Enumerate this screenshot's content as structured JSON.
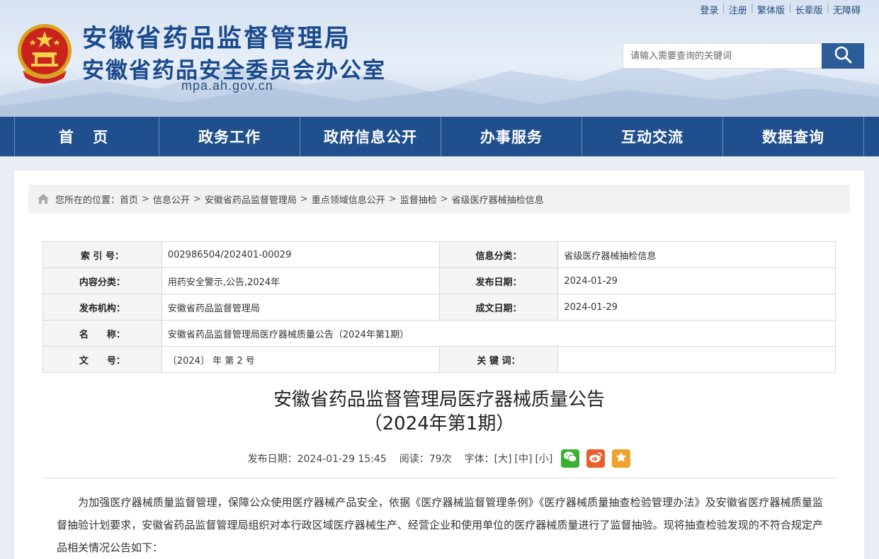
{
  "header": {
    "title_main": "安徽省药品监督管理局",
    "title_sub": "安徽省药品安全委员会办公室",
    "domain": "mpa.ah.gov.cn",
    "top_links": [
      "登录",
      "注册",
      "繁体版",
      "长辈版",
      "无障碍"
    ],
    "search_placeholder": "请输入需要查询的关键词",
    "emblem_icon": "national-emblem-icon",
    "search_icon": "magnifier-icon"
  },
  "nav": {
    "items": [
      "首 页",
      "政务工作",
      "政府信息公开",
      "办事服务",
      "互动交流",
      "数据查询"
    ]
  },
  "breadcrumb": {
    "prefix": "您所在的位置：",
    "items": [
      "首页",
      "信息公开",
      "安徽省药品监督管理局",
      "重点领域信息公开",
      "监督抽检",
      "省级医疗器械抽检信息"
    ],
    "separator": ">"
  },
  "meta": {
    "index_label": "索 引 号：",
    "index_value": "002986504/202401-00029",
    "category_label": "信息分类：",
    "category_value": "省级医疗器械抽检信息",
    "content_type_label": "内容分类：",
    "content_type_value": "用药安全警示,公告,2024年",
    "publish_date_label": "发布日期：",
    "publish_date_value": "2024-01-29",
    "org_label": "发布机构：",
    "org_value": "安徽省药品监督管理局",
    "created_date_label": "成文日期：",
    "created_date_value": "2024-01-29",
    "name_label": "名　　称：",
    "name_value": "安徽省药品监督管理局医疗器械质量公告（2024年第1期）",
    "doc_no_label": "文　　号：",
    "doc_no_value": "〔2024〕 年 第 2 号",
    "keywords_label": "关 键 词：",
    "keywords_value": ""
  },
  "article": {
    "title_line1": "安徽省药品监督管理局医疗器械质量公告",
    "title_line2": "（2024年第1期）",
    "publish_info": "发布日期：2024-01-29 15:45",
    "reads": "阅读：79次",
    "font_size_label": "字体：",
    "font_large": "[大]",
    "font_medium": "[中]",
    "font_small": "[小]",
    "share_icons": [
      "wechat-icon",
      "weibo-icon",
      "favorite-icon"
    ],
    "paragraph1": "为加强医疗器械质量监督管理，保障公众使用医疗器械产品安全，依据《医疗器械监督管理条例》《医疗器械质量抽查检验管理办法》及安徽省医疗器械质量监督抽验计划要求，安徽省药品监督管理局组织对本行政区域医疗器械生产、经营企业和使用单位的医疗器械质量进行了监督抽验。现将抽查检验发现的不符合规定产品相关情况公告如下："
  },
  "colors": {
    "nav_bg": "#1f4f8d",
    "title_blue": "#1a4a8c",
    "search_btn": "#2c5d9a"
  }
}
